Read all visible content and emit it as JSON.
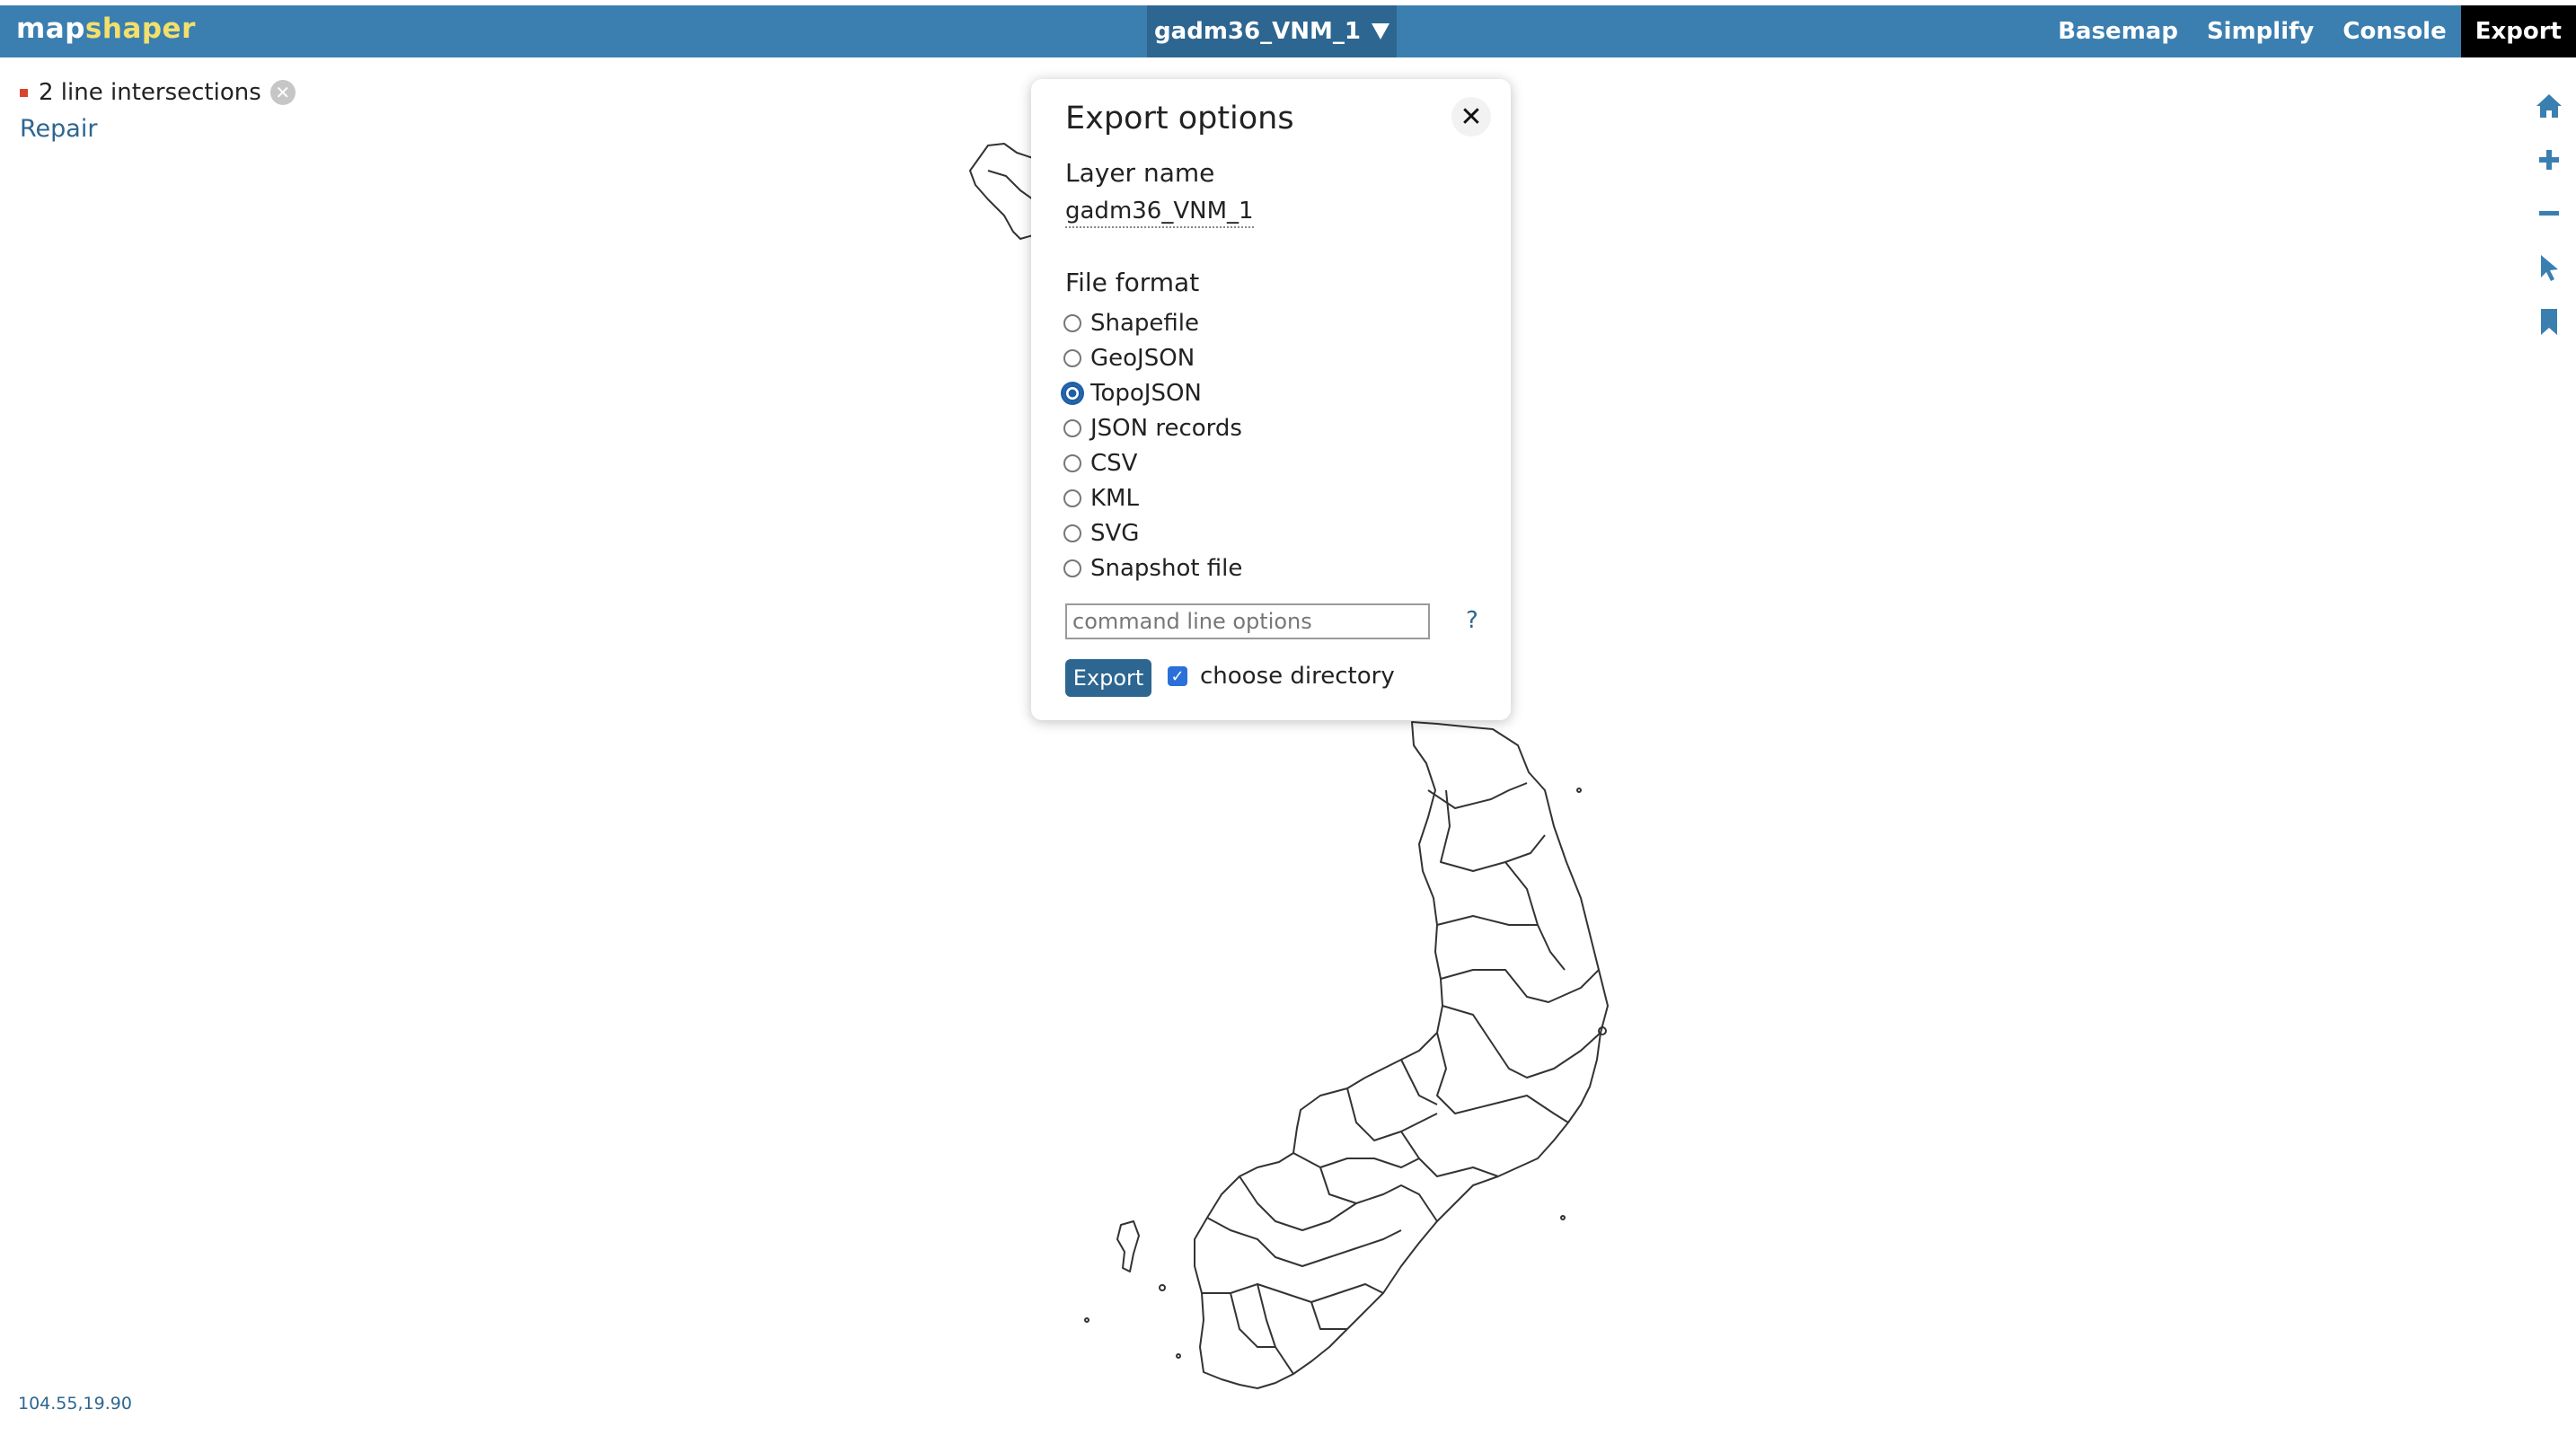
{
  "app": {
    "logo_part1": "map",
    "logo_part2": "shaper",
    "logo_highlight_color": "#f3e06a",
    "topbar_color": "#3b7fb1"
  },
  "layer_selector": {
    "label": "gadm36_VNM_1",
    "icon": "caret-down-icon"
  },
  "nav": {
    "items": [
      {
        "label": "Basemap",
        "active": false
      },
      {
        "label": "Simplify",
        "active": false
      },
      {
        "label": "Console",
        "active": false
      },
      {
        "label": "Export",
        "active": true
      }
    ]
  },
  "intersections": {
    "message": "2 line intersections",
    "repair_label": "Repair",
    "marker_color": "#d9442c"
  },
  "tools": {
    "icons": [
      "home-icon",
      "zoom-in-icon",
      "zoom-out-icon",
      "pointer-icon",
      "bookmark-icon"
    ],
    "color": "#3b7fb1"
  },
  "export_dialog": {
    "title": "Export options",
    "close_icon": "close-icon",
    "layer_name_label": "Layer name",
    "layer_name_value": "gadm36_VNM_1",
    "file_format_label": "File format",
    "formats": [
      {
        "label": "Shapefile",
        "checked": false
      },
      {
        "label": "GeoJSON",
        "checked": false
      },
      {
        "label": "TopoJSON",
        "checked": true
      },
      {
        "label": "JSON records",
        "checked": false
      },
      {
        "label": "CSV",
        "checked": false
      },
      {
        "label": "KML",
        "checked": false
      },
      {
        "label": "SVG",
        "checked": false
      },
      {
        "label": "Snapshot file",
        "checked": false
      }
    ],
    "command_placeholder": "command line options",
    "help_label": "?",
    "export_button": "Export",
    "choose_directory_label": "choose directory",
    "choose_directory_checked": true
  },
  "status": {
    "coordinates": "104.55,19.90"
  }
}
